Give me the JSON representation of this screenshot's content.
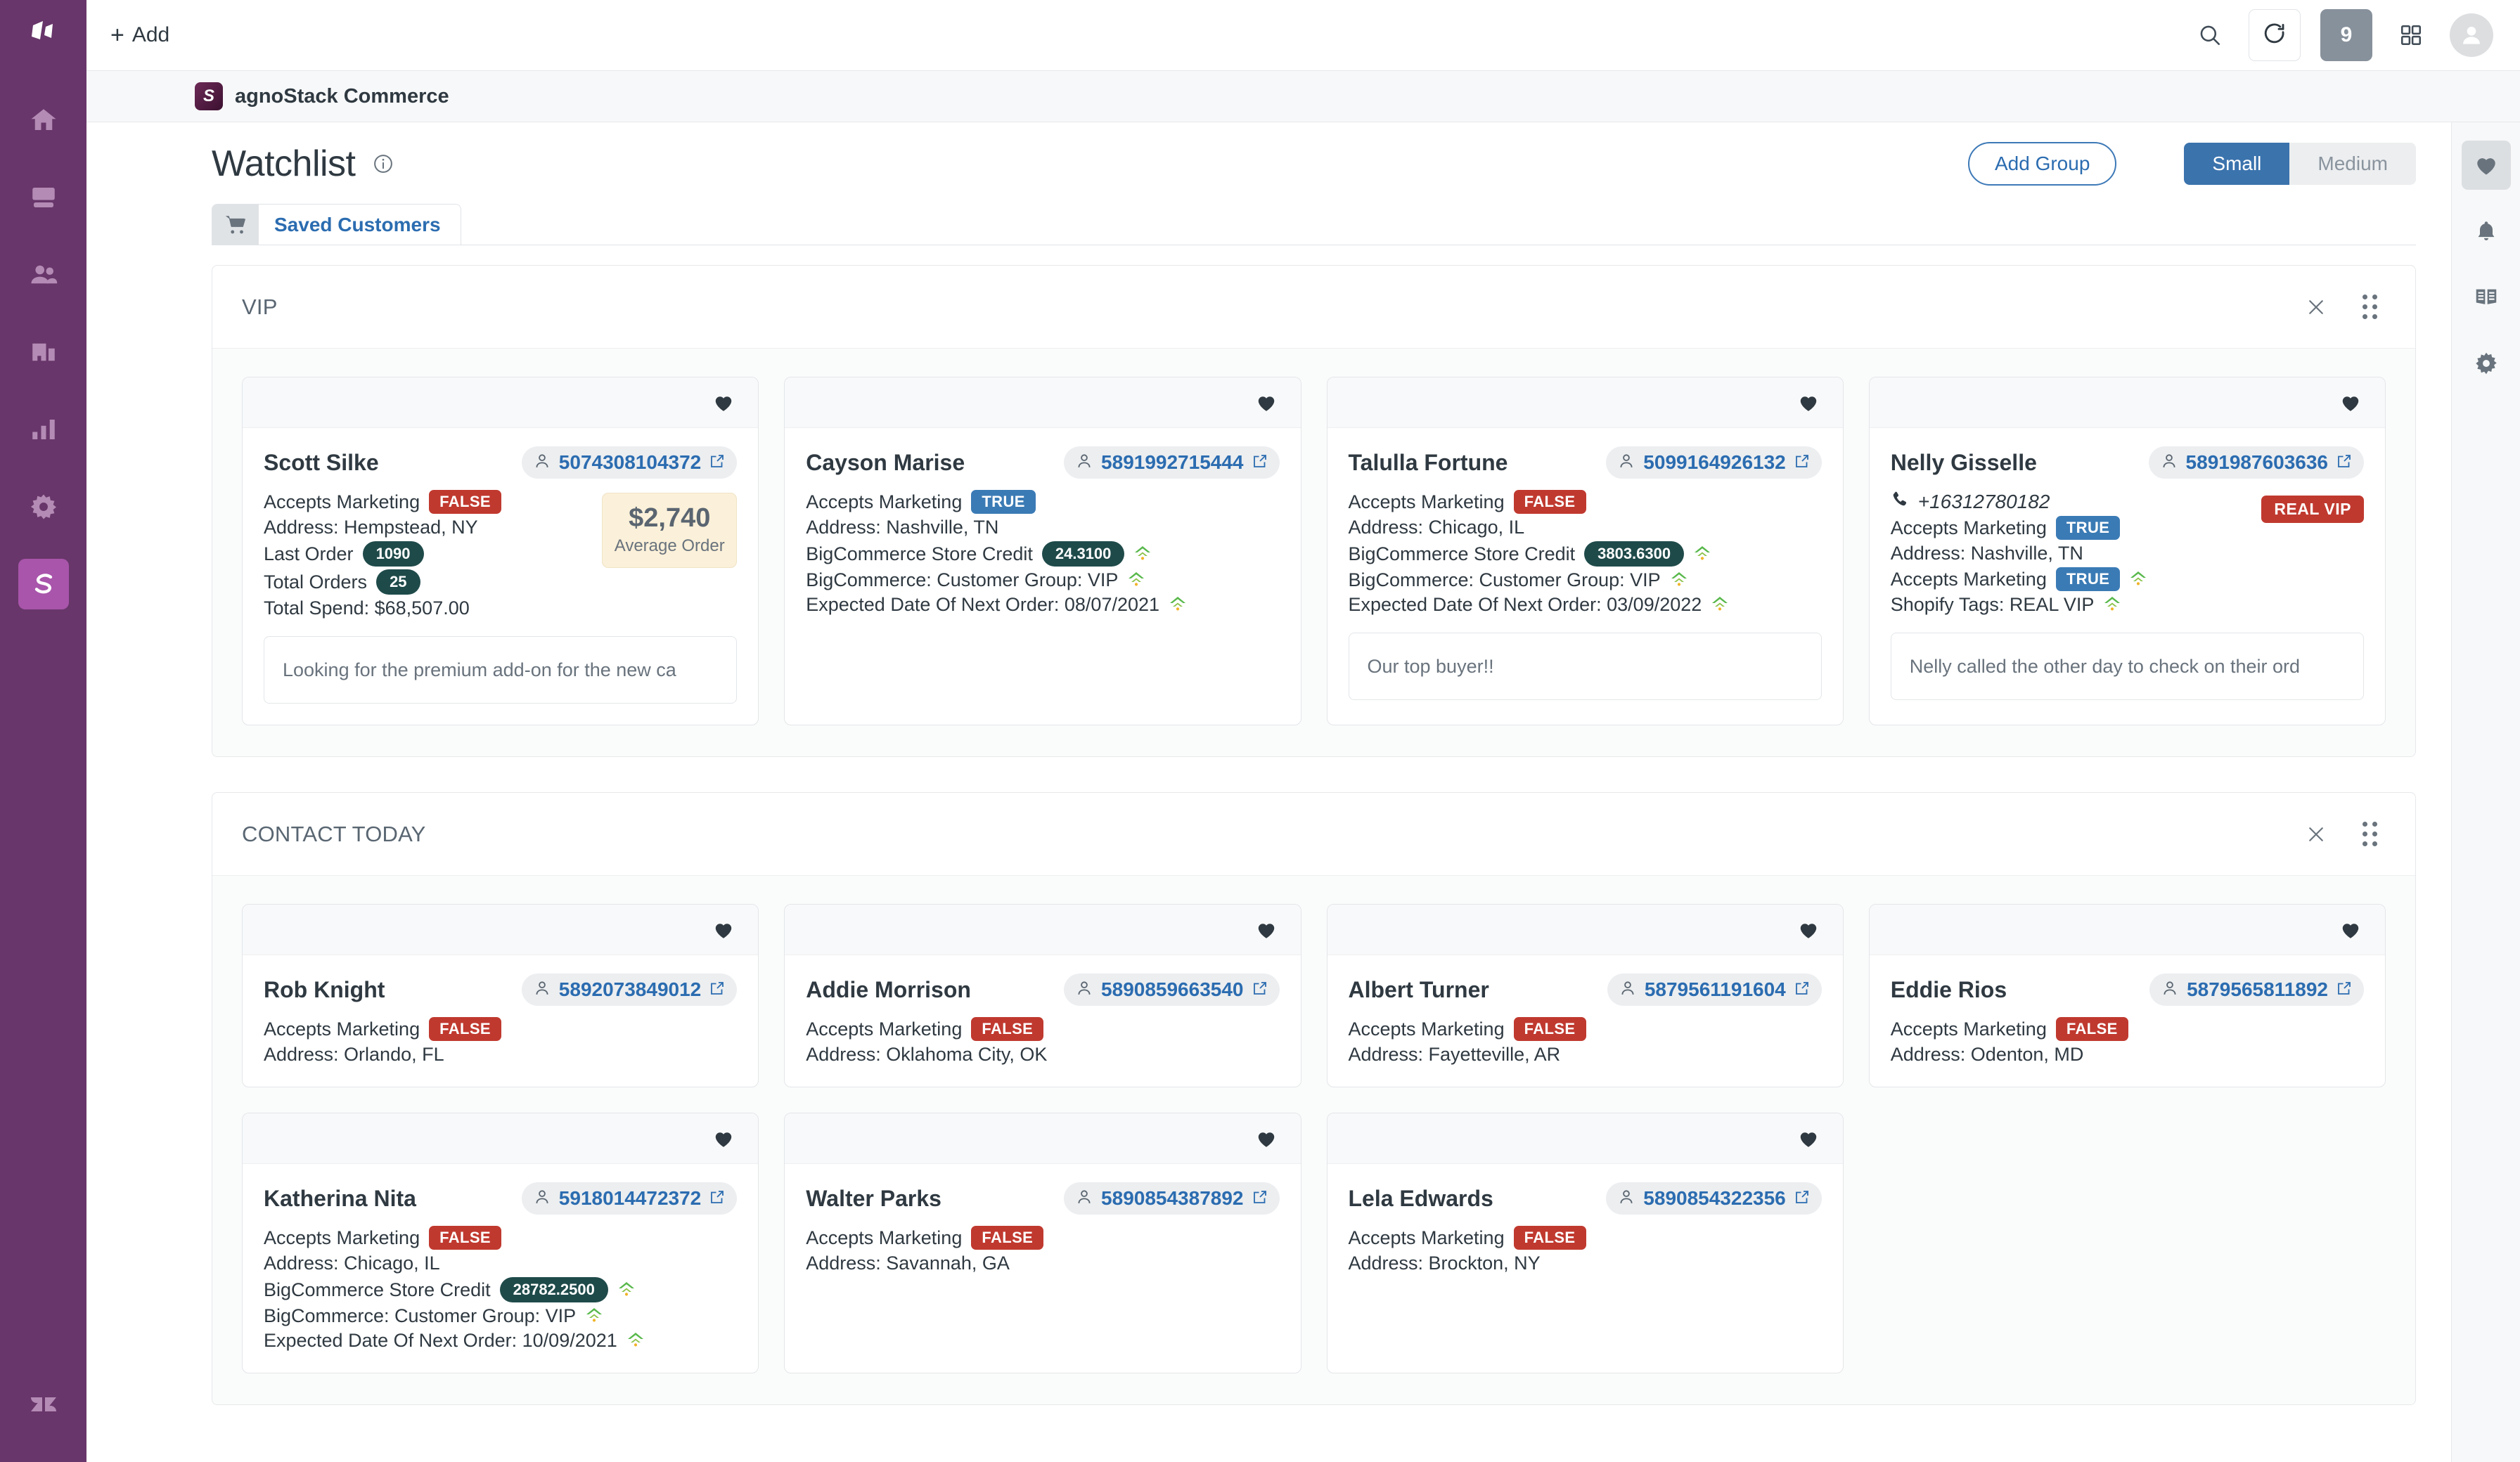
{
  "topbar": {
    "add_label": "Add",
    "notification_count": "9",
    "icons": [
      "search-icon",
      "refresh-icon",
      "apps-grid-icon",
      "avatar-icon"
    ]
  },
  "app_strip": {
    "logo_letter": "S",
    "name": "agnoStack Commerce"
  },
  "page": {
    "title": "Watchlist",
    "add_group_label": "Add Group",
    "size_options": [
      {
        "label": "Small",
        "selected": true
      },
      {
        "label": "Medium",
        "selected": false
      }
    ]
  },
  "tabs": [
    {
      "label": "Saved Customers",
      "icon": "shopping-cart-icon",
      "active": true
    }
  ],
  "left_rail": {
    "items": [
      {
        "name": "home-icon"
      },
      {
        "name": "views-icon"
      },
      {
        "name": "customers-icon"
      },
      {
        "name": "organizations-icon"
      },
      {
        "name": "reporting-icon"
      },
      {
        "name": "admin-gear-icon"
      },
      {
        "name": "agnostack-app-icon",
        "active": true
      }
    ],
    "bottom": {
      "name": "zendesk-logo-icon"
    }
  },
  "right_rail": {
    "items": [
      {
        "name": "heart-icon",
        "active": true
      },
      {
        "name": "bell-icon",
        "active": false
      },
      {
        "name": "book-icon",
        "active": false
      },
      {
        "name": "gear-icon",
        "active": false
      }
    ]
  },
  "colors": {
    "brand_purple": "#68366a",
    "accent_blue": "#2b6cb0",
    "badge_false": "#c0392f",
    "badge_true": "#3b7bb5",
    "pill_dark": "#1f4a4a",
    "avg_bg": "#fbf0d9"
  },
  "groups": [
    {
      "title": "VIP",
      "cards": [
        {
          "name": "Scott Silke",
          "id": "5074308104372",
          "accepts_marketing": "FALSE",
          "accepts_marketing_value": false,
          "address": "Address: Hempstead, NY",
          "extra_rows": [
            {
              "label": "Last Order",
              "pill": "1090",
              "sync": false
            },
            {
              "label": "Total Orders",
              "pill": "25",
              "sync": false
            },
            {
              "label": "Total Spend: $68,507.00",
              "pill": null,
              "sync": false
            }
          ],
          "avg_order": {
            "amount": "$2,740",
            "label": "Average Order"
          },
          "note": "Looking for the premium add-on for the new ca",
          "phone": null,
          "vip_badge": null
        },
        {
          "name": "Cayson Marise",
          "id": "5891992715444",
          "accepts_marketing": "TRUE",
          "accepts_marketing_value": true,
          "address": "Address: Nashville, TN",
          "extra_rows": [
            {
              "label": "BigCommerce Store Credit",
              "pill": "24.3100",
              "sync": true
            },
            {
              "label": "BigCommerce: Customer Group: VIP",
              "pill": null,
              "sync": true
            },
            {
              "label": "Expected Date Of Next Order: 08/07/2021",
              "pill": null,
              "sync": true
            }
          ],
          "avg_order": null,
          "note": null,
          "phone": null,
          "vip_badge": null
        },
        {
          "name": "Talulla Fortune",
          "id": "5099164926132",
          "accepts_marketing": "FALSE",
          "accepts_marketing_value": false,
          "address": "Address: Chicago, IL",
          "extra_rows": [
            {
              "label": "BigCommerce Store Credit",
              "pill": "3803.6300",
              "sync": true
            },
            {
              "label": "BigCommerce: Customer Group: VIP",
              "pill": null,
              "sync": true
            },
            {
              "label": "Expected Date Of Next Order: 03/09/2022",
              "pill": null,
              "sync": true
            }
          ],
          "avg_order": null,
          "note": "Our top buyer!!",
          "phone": null,
          "vip_badge": null
        },
        {
          "name": "Nelly Gisselle",
          "id": "5891987603636",
          "accepts_marketing": "TRUE",
          "accepts_marketing_value": true,
          "address": "Address: Nashville, TN",
          "extra_rows": [
            {
              "label": "Accepts Marketing",
              "badge": "TRUE",
              "badge_true": true,
              "sync": true
            },
            {
              "label": "Shopify Tags: REAL VIP",
              "pill": null,
              "sync": true
            }
          ],
          "avg_order": null,
          "note": "Nelly called the other day to check on their ord",
          "phone": "+16312780182",
          "vip_badge": "REAL VIP"
        }
      ]
    },
    {
      "title": "CONTACT TODAY",
      "cards": [
        {
          "name": "Rob Knight",
          "id": "5892073849012",
          "accepts_marketing": "FALSE",
          "accepts_marketing_value": false,
          "address": "Address: Orlando, FL",
          "extra_rows": [],
          "avg_order": null,
          "note": null,
          "phone": null,
          "vip_badge": null
        },
        {
          "name": "Addie Morrison",
          "id": "5890859663540",
          "accepts_marketing": "FALSE",
          "accepts_marketing_value": false,
          "address": "Address: Oklahoma City, OK",
          "extra_rows": [],
          "avg_order": null,
          "note": null,
          "phone": null,
          "vip_badge": null
        },
        {
          "name": "Albert Turner",
          "id": "5879561191604",
          "accepts_marketing": "FALSE",
          "accepts_marketing_value": false,
          "address": "Address: Fayetteville, AR",
          "extra_rows": [],
          "avg_order": null,
          "note": null,
          "phone": null,
          "vip_badge": null
        },
        {
          "name": "Eddie Rios",
          "id": "5879565811892",
          "accepts_marketing": "FALSE",
          "accepts_marketing_value": false,
          "address": "Address: Odenton, MD",
          "extra_rows": [],
          "avg_order": null,
          "note": null,
          "phone": null,
          "vip_badge": null
        },
        {
          "name": "Katherina Nita",
          "id": "5918014472372",
          "accepts_marketing": "FALSE",
          "accepts_marketing_value": false,
          "address": "Address: Chicago, IL",
          "extra_rows": [
            {
              "label": "BigCommerce Store Credit",
              "pill": "28782.2500",
              "sync": true
            },
            {
              "label": "BigCommerce: Customer Group: VIP",
              "pill": null,
              "sync": true
            },
            {
              "label": "Expected Date Of Next Order: 10/09/2021",
              "pill": null,
              "sync": true
            }
          ],
          "avg_order": null,
          "note": null,
          "phone": null,
          "vip_badge": null
        },
        {
          "name": "Walter Parks",
          "id": "5890854387892",
          "accepts_marketing": "FALSE",
          "accepts_marketing_value": false,
          "address": "Address: Savannah, GA",
          "extra_rows": [],
          "avg_order": null,
          "note": null,
          "phone": null,
          "vip_badge": null
        },
        {
          "name": "Lela Edwards",
          "id": "5890854322356",
          "accepts_marketing": "FALSE",
          "accepts_marketing_value": false,
          "address": "Address: Brockton, NY",
          "extra_rows": [],
          "avg_order": null,
          "note": null,
          "phone": null,
          "vip_badge": null
        }
      ]
    }
  ]
}
